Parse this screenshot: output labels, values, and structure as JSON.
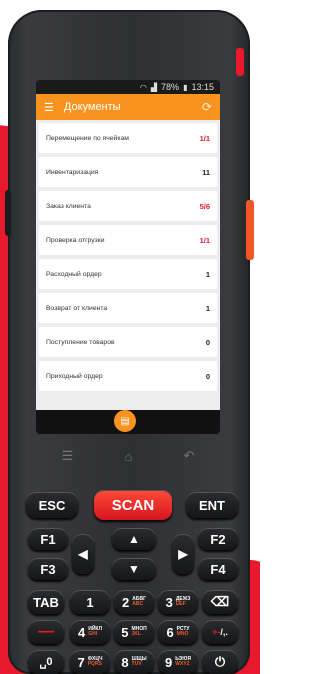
{
  "status": {
    "wifi": "wifi-icon",
    "signal": "signal-icon",
    "battery_percent": "78%",
    "time": "13:15"
  },
  "app": {
    "title": "Документы",
    "menu_icon": "menu-icon",
    "sync_icon": "sync-icon",
    "accent": "#f7931e",
    "fab_icon": "barcode-icon"
  },
  "documents": [
    {
      "label": "Перемещение по ячейкам",
      "count": "1/1",
      "color": "#e8192c"
    },
    {
      "label": "Инвентаризация",
      "count": "11",
      "color": "#222222"
    },
    {
      "label": "Заказ клиента",
      "count": "5/6",
      "color": "#e8192c"
    },
    {
      "label": "Проверка отгрузки",
      "count": "1/1",
      "color": "#e8192c"
    },
    {
      "label": "Расходный ордер",
      "count": "1",
      "color": "#222222"
    },
    {
      "label": "Возврат от клиента",
      "count": "1",
      "color": "#222222"
    },
    {
      "label": "Поступление товаров",
      "count": "0",
      "color": "#222222"
    },
    {
      "label": "Приходный ордер",
      "count": "0",
      "color": "#222222"
    }
  ],
  "keys": {
    "esc": "ESC",
    "scan": "SCAN",
    "ent": "ENT",
    "f1": "F1",
    "f2": "F2",
    "f3": "F3",
    "f4": "F4",
    "tab": "TAB",
    "k1": "1",
    "k2": "2",
    "k2_sub": "ABC",
    "k2_cyr": "АБВГ",
    "k3": "3",
    "k3_sub": "DEF",
    "k3_cyr": "ДЕЖЗ",
    "k4": "4",
    "k4_sub": "GHI",
    "k4_cyr": "ИЙКЛ",
    "k5": "5",
    "k5_sub": "JKL",
    "k5_cyr": "МНОП",
    "k6": "6",
    "k6_sub": "MNO",
    "k6_cyr": "РСТУ",
    "k7": "7",
    "k7_sub": "PQRS",
    "k7_cyr": "ФХЦЧ",
    "k8": "8",
    "k8_sub": "TUV",
    "k8_cyr": "ШЩЫ",
    "k9": "9",
    "k9_sub": "WXYZ",
    "k9_cyr": "ЬЭЮЯ",
    "k0": "0",
    "space": "␣",
    "plusminus": "+-",
    "slash": "/,.",
    "power": "⏻",
    "backspace": "⌫"
  }
}
